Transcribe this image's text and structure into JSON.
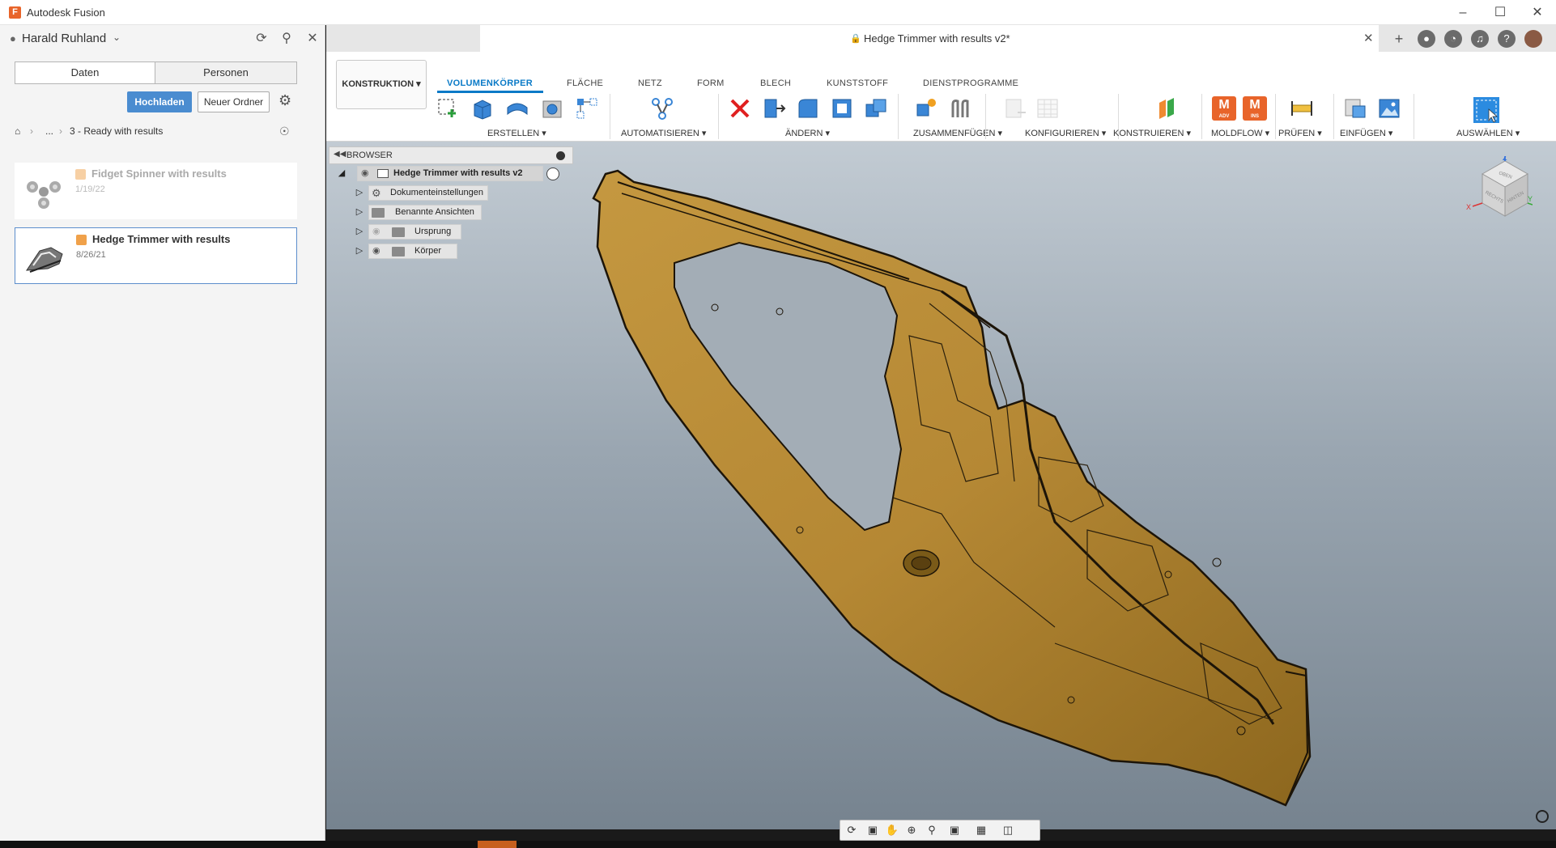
{
  "app": {
    "title": "Autodesk Fusion"
  },
  "user": {
    "name": "Harald Ruhland"
  },
  "data_panel": {
    "tabs": [
      "Daten",
      "Personen"
    ],
    "upload_label": "Hochladen",
    "new_folder_label": "Neuer Ordner",
    "breadcrumb": {
      "ellipsis": "...",
      "folder": "3 - Ready with results"
    },
    "files": [
      {
        "name": "Fidget Spinner with results",
        "date": "1/19/22"
      },
      {
        "name": "Hedge Trimmer with results",
        "date": "8/26/21"
      }
    ]
  },
  "document": {
    "tab_title": "Hedge Trimmer with results v2*"
  },
  "toolbar": {
    "workspace_label": "KONSTRUKTION",
    "ribbon_tabs": [
      "VOLUMENKÖRPER",
      "FLÄCHE",
      "NETZ",
      "FORM",
      "BLECH",
      "KUNSTSTOFF",
      "DIENSTPROGRAMME"
    ],
    "active_tab": "VOLUMENKÖRPER",
    "groups": [
      "ERSTELLEN",
      "AUTOMATISIEREN",
      "ÄNDERN",
      "ZUSAMMENFÜGEN",
      "KONFIGURIEREN",
      "KONSTRUIEREN",
      "MOLDFLOW",
      "PRÜFEN",
      "EINFÜGEN",
      "AUSWÄHLEN"
    ],
    "moldflow_badges": [
      "ADV",
      "INS"
    ]
  },
  "browser": {
    "title": "BROWSER",
    "root": "Hedge Trimmer with results v2",
    "nodes": [
      "Dokumenteinstellungen",
      "Benannte Ansichten",
      "Ursprung",
      "Körper"
    ]
  },
  "viewcube": {
    "faces": [
      "OBEN",
      "RECHTS",
      "HINTEN"
    ],
    "axes": [
      "Z",
      "X",
      "Y"
    ]
  },
  "colors": {
    "accent": "#0a7ac7",
    "upload_button": "#4a8cd0",
    "model_body": "#b8862a",
    "brand_orange": "#e8642a"
  },
  "icons": {
    "user": "user-icon",
    "refresh": "refresh-icon",
    "search": "search-icon",
    "close": "close-icon",
    "grid": "grid-icon",
    "file": "file-icon",
    "save": "save-icon",
    "undo": "undo-icon",
    "redo": "redo-icon",
    "settings": "gear-icon",
    "home": "home-icon",
    "globe": "globe-icon",
    "lock": "lock-icon",
    "eye": "eye-icon",
    "folder": "folder-icon"
  }
}
